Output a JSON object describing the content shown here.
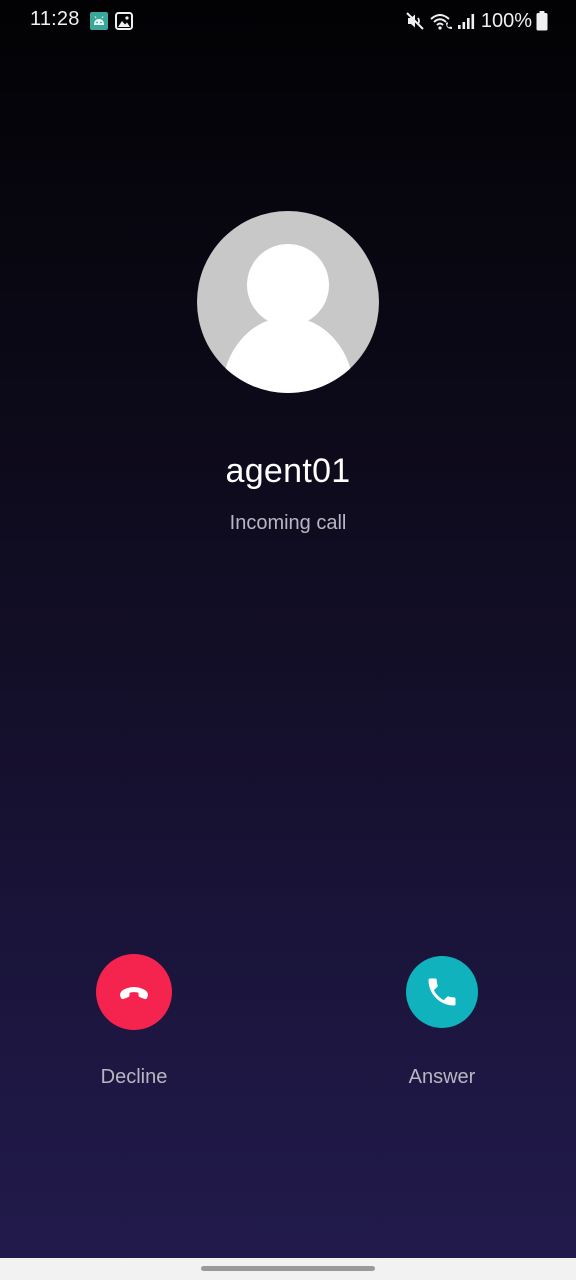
{
  "status_bar": {
    "time": "11:28",
    "notifications": [
      "android-app-icon",
      "gallery-icon"
    ],
    "icons": [
      "mute-icon",
      "wifi-calling-icon",
      "signal-icon",
      "battery-icon"
    ],
    "battery_percent": "100%"
  },
  "caller": {
    "name": "agent01",
    "status": "Incoming call",
    "avatar_icon": "person-icon"
  },
  "actions": {
    "decline": {
      "label": "Decline",
      "icon": "phone-hangup-icon",
      "color": "#f4244f"
    },
    "answer": {
      "label": "Answer",
      "icon": "phone-icon",
      "color": "#10b2bd"
    }
  },
  "nav": {
    "home_indicator": "home-handle"
  }
}
